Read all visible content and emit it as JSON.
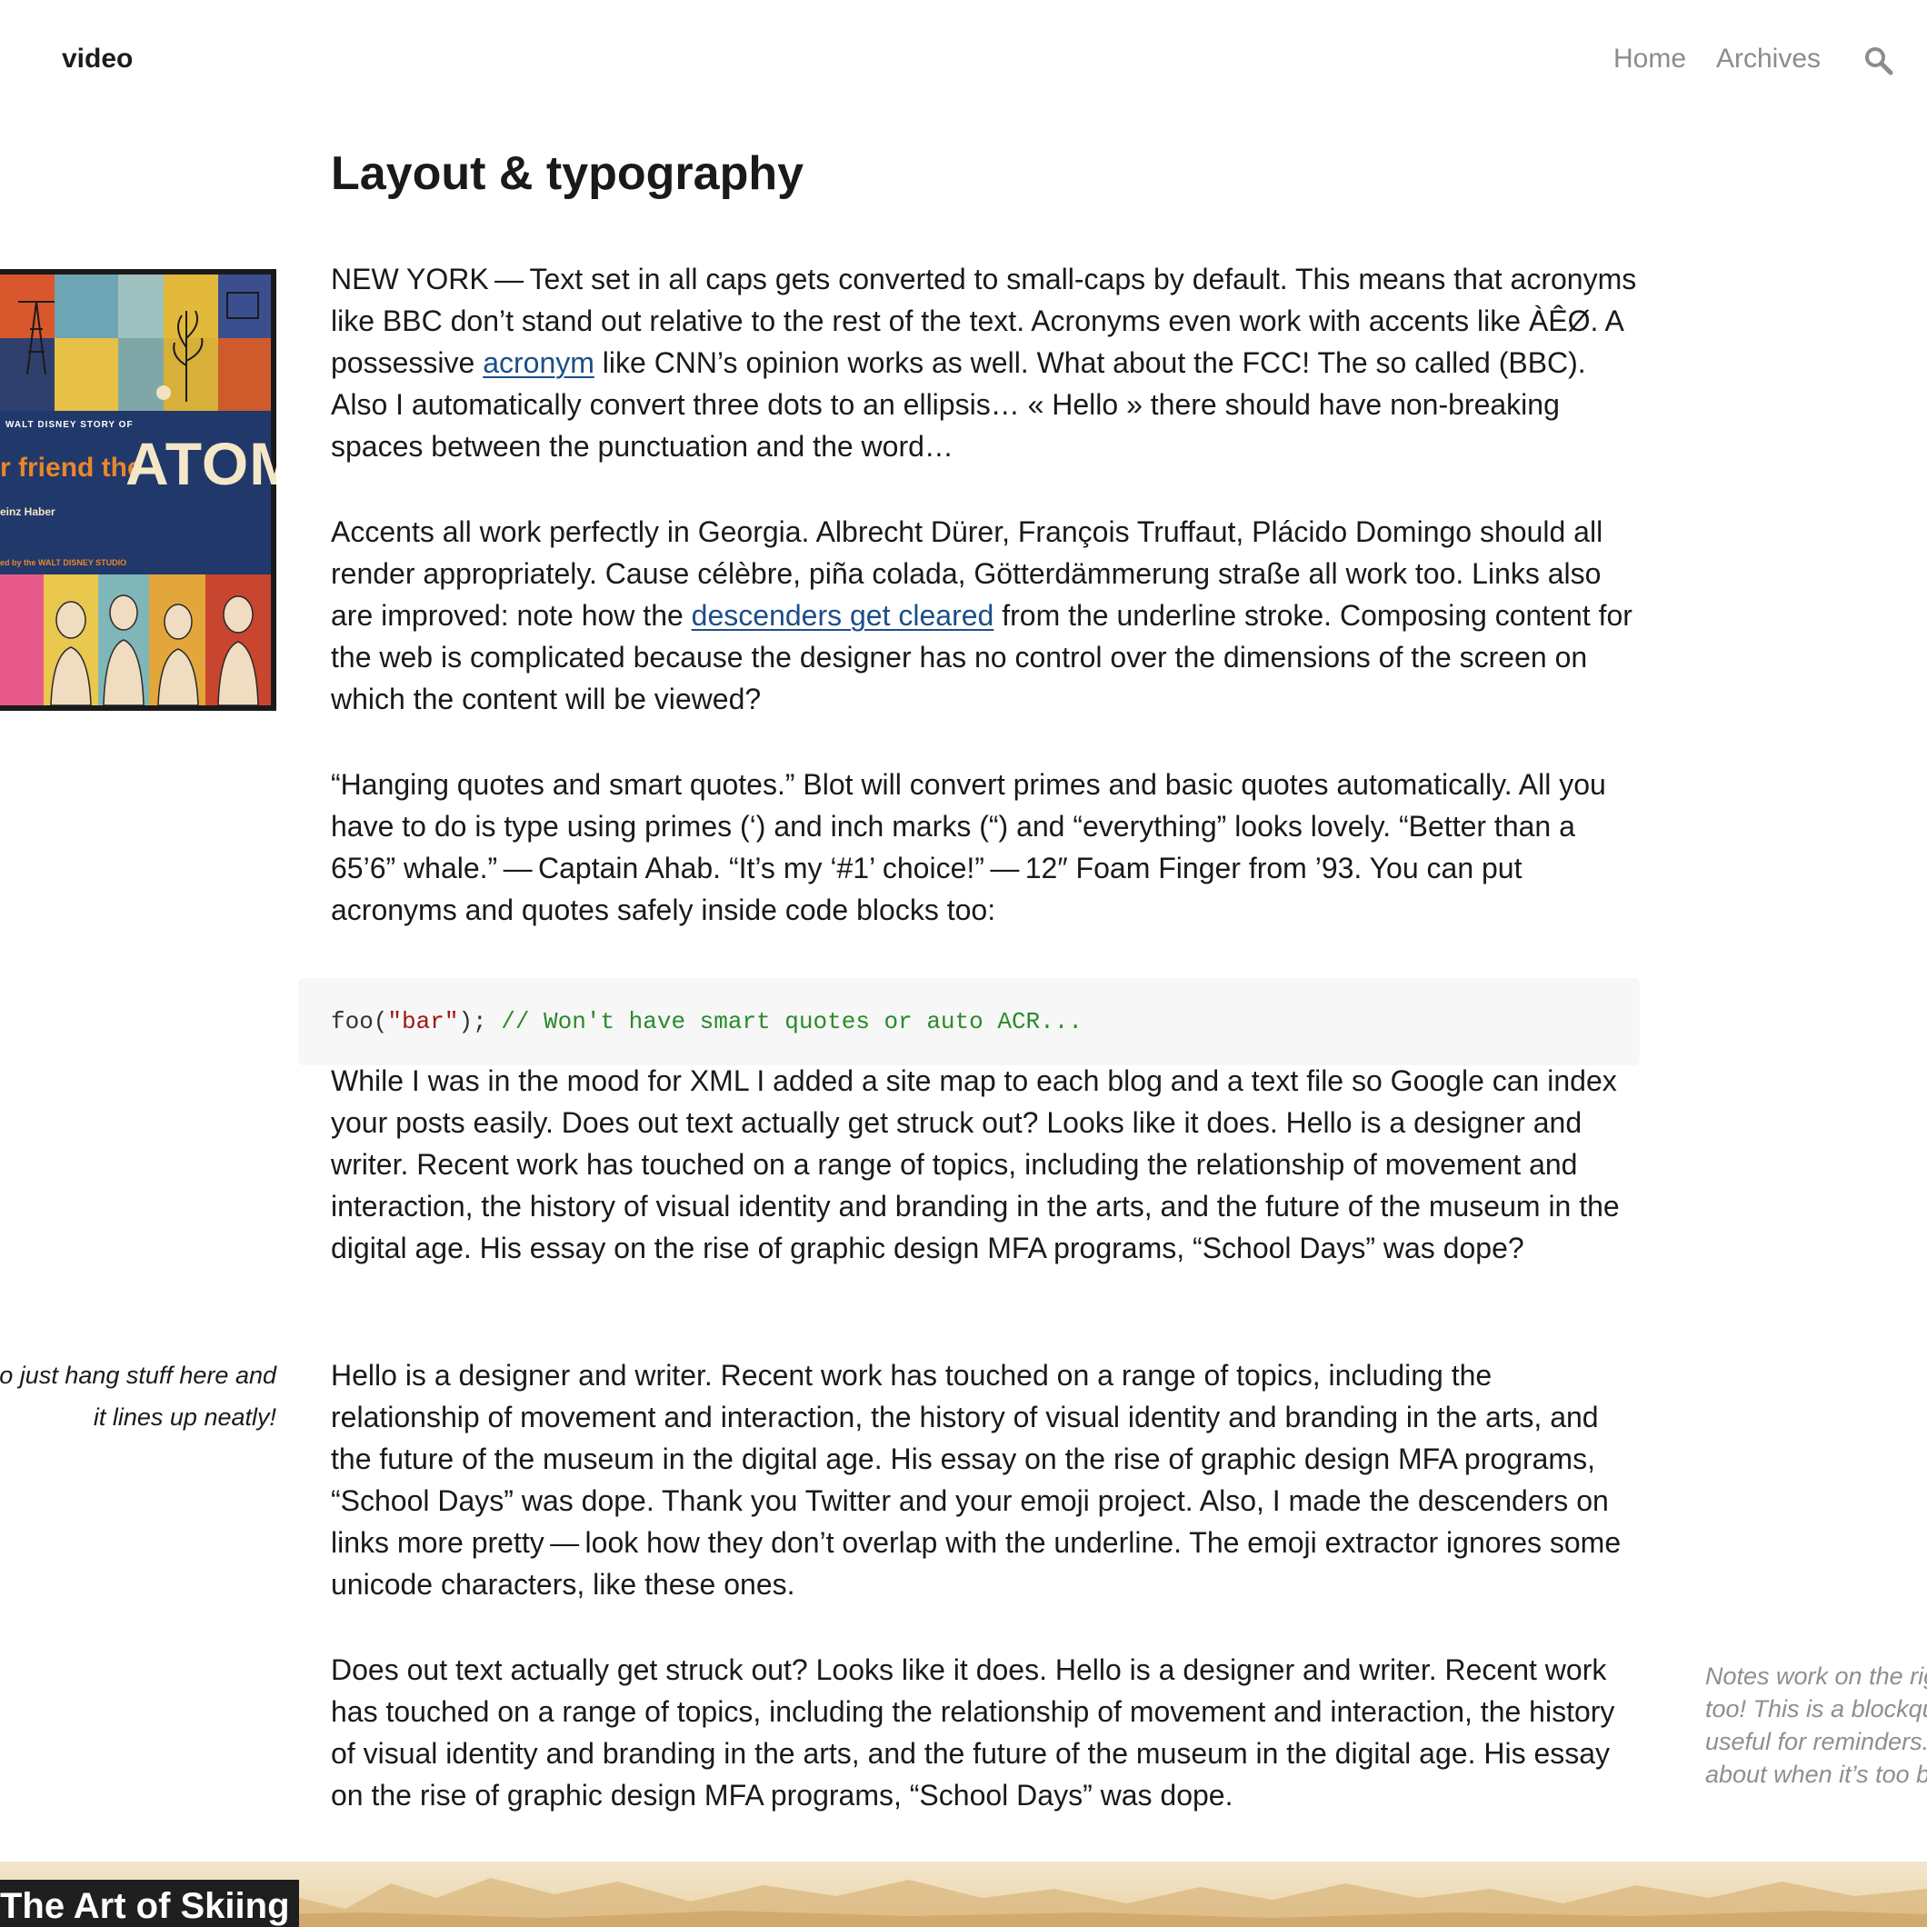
{
  "header": {
    "site_title": "video",
    "nav": {
      "home": "Home",
      "archives": "Archives",
      "search_icon": "search-icon"
    }
  },
  "article": {
    "title": "Layout & typography",
    "p1": {
      "a": "NEW YORK — Text set in all caps gets converted to small-caps by default. This means that acronyms like BBC don’t stand out relative to the rest of the text. Acronyms even work with accents like ÀÊØ. A possessive ",
      "link": "acronym",
      "b": " like CNN’s opinion works as well. What about the FCC! The so called (BBC). Also I automatically convert three dots to an ellipsis… « Hello » there should have non-breaking spaces between the punctuation and the word…"
    },
    "p2": {
      "a": "Accents all work perfectly in Georgia. Albrecht Dürer, François Truffaut, Plácido Domingo should all render appropriately. Cause célèbre, piña colada, Götterdämmerung straße all work too. Links also are improved: note how the ",
      "link": "descenders get cleared",
      "b": " from the underline stroke. Composing content for the web is complicated because the designer has no control over the dimensions of the screen on which the content will be viewed?"
    },
    "p3": "“Hanging quotes and smart quotes.” Blot will convert primes and basic quotes automatically. All you have to do is type using primes (‘) and inch marks (“) and “everything” looks lovely. “Better than a 65’6” whale.” — Captain Ahab. “It’s my ‘#1’ choice!” — 12″ Foam Finger from ’93. You can put acronyms and quotes safely inside code blocks too:",
    "code": {
      "fn": "foo(",
      "str": "\"bar\"",
      "end": "); ",
      "comment": "// Won't have smart quotes or auto ACR..."
    },
    "p4": "While I was in the mood for XML I added a site map to each blog and a text file so Google can index your posts easily. Does out text actually get struck out? Looks like it does. Hello is a designer and writer. Recent work has touched on a range of topics, including the relationship of movement and interaction, the history of visual identity and branding in the arts, and the future of the museum in the digital age. His essay on the rise of graphic design MFA programs, “School Days” was dope?",
    "p5": "Hello is a designer and writer. Recent work has touched on a range of topics, including the relationship of movement and interaction, the history of visual identity and branding in the arts, and the future of the museum in the digital age. His essay on the rise of graphic design MFA programs, “School Days” was dope. Thank you Twitter and your emoji project. Also, I made the descenders on links more pretty — look how they don’t overlap with the underline. The emoji extractor ignores some unicode characters, like these ones.",
    "p6": "Does out text actually get struck out? Looks like it does. Hello is a designer and writer. Recent work has touched on a range of topics, including the relationship of movement and interaction, the history of visual identity and branding in the arts, and the future of the museum in the digital age. His essay on the rise of graphic design MFA programs, “School Days” was dope."
  },
  "figure_atom": {
    "subtitle": "WALT DISNEY STORY OF",
    "friend": "r friend the",
    "word": "ATOM",
    "author": "einz Haber",
    "studio": "ed by the WALT DISNEY STUDIO"
  },
  "notes": {
    "left": "I can also just hang stuff here and it lines up neatly!",
    "right": "Notes work on the right side too! This is a blockquote, useful for reminders. What about when it’s too big?"
  },
  "banner": {
    "label": "The Art of Skiing"
  },
  "colors": {
    "link": "#1b4e8a",
    "nav": "#8c8c8c",
    "note_right": "#8f8f8f",
    "code_bg": "#f7f7f7",
    "code_string": "#a31515",
    "code_comment": "#2a8a2a"
  }
}
